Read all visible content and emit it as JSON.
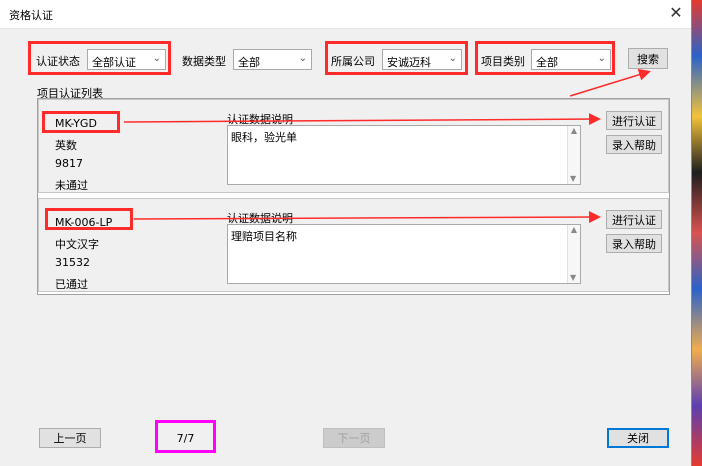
{
  "window": {
    "title": "资格认证",
    "close_glyph": "✕"
  },
  "filters": {
    "status": {
      "label": "认证状态",
      "value": "全部认证"
    },
    "data_type": {
      "label": "数据类型",
      "value": "全部"
    },
    "company": {
      "label": "所属公司",
      "value": "安诚迈科"
    },
    "category": {
      "label": "项目类别",
      "value": "全部"
    },
    "search_label": "搜索"
  },
  "list": {
    "title": "项目认证列表",
    "items": [
      {
        "code": "MK-YGD",
        "language": "英数",
        "number": "9817",
        "status": "未通过",
        "desc_label": "认证数据说明",
        "desc": "眼科，验光单",
        "certify_label": "进行认证",
        "help_label": "录入帮助"
      },
      {
        "code": "MK-006-LP",
        "language": "中文汉字",
        "number": "31532",
        "status": "已通过",
        "desc_label": "认证数据说明",
        "desc": "理赔项目名称",
        "certify_label": "进行认证",
        "help_label": "录入帮助"
      }
    ]
  },
  "footer": {
    "prev_label": "上一页",
    "page": "7/7",
    "next_label": "下一页",
    "close_label": "关闭"
  },
  "colors": {
    "annotation_red": "#ff2b2b",
    "annotation_magenta": "#ff00ff",
    "accent": "#0078d7"
  }
}
